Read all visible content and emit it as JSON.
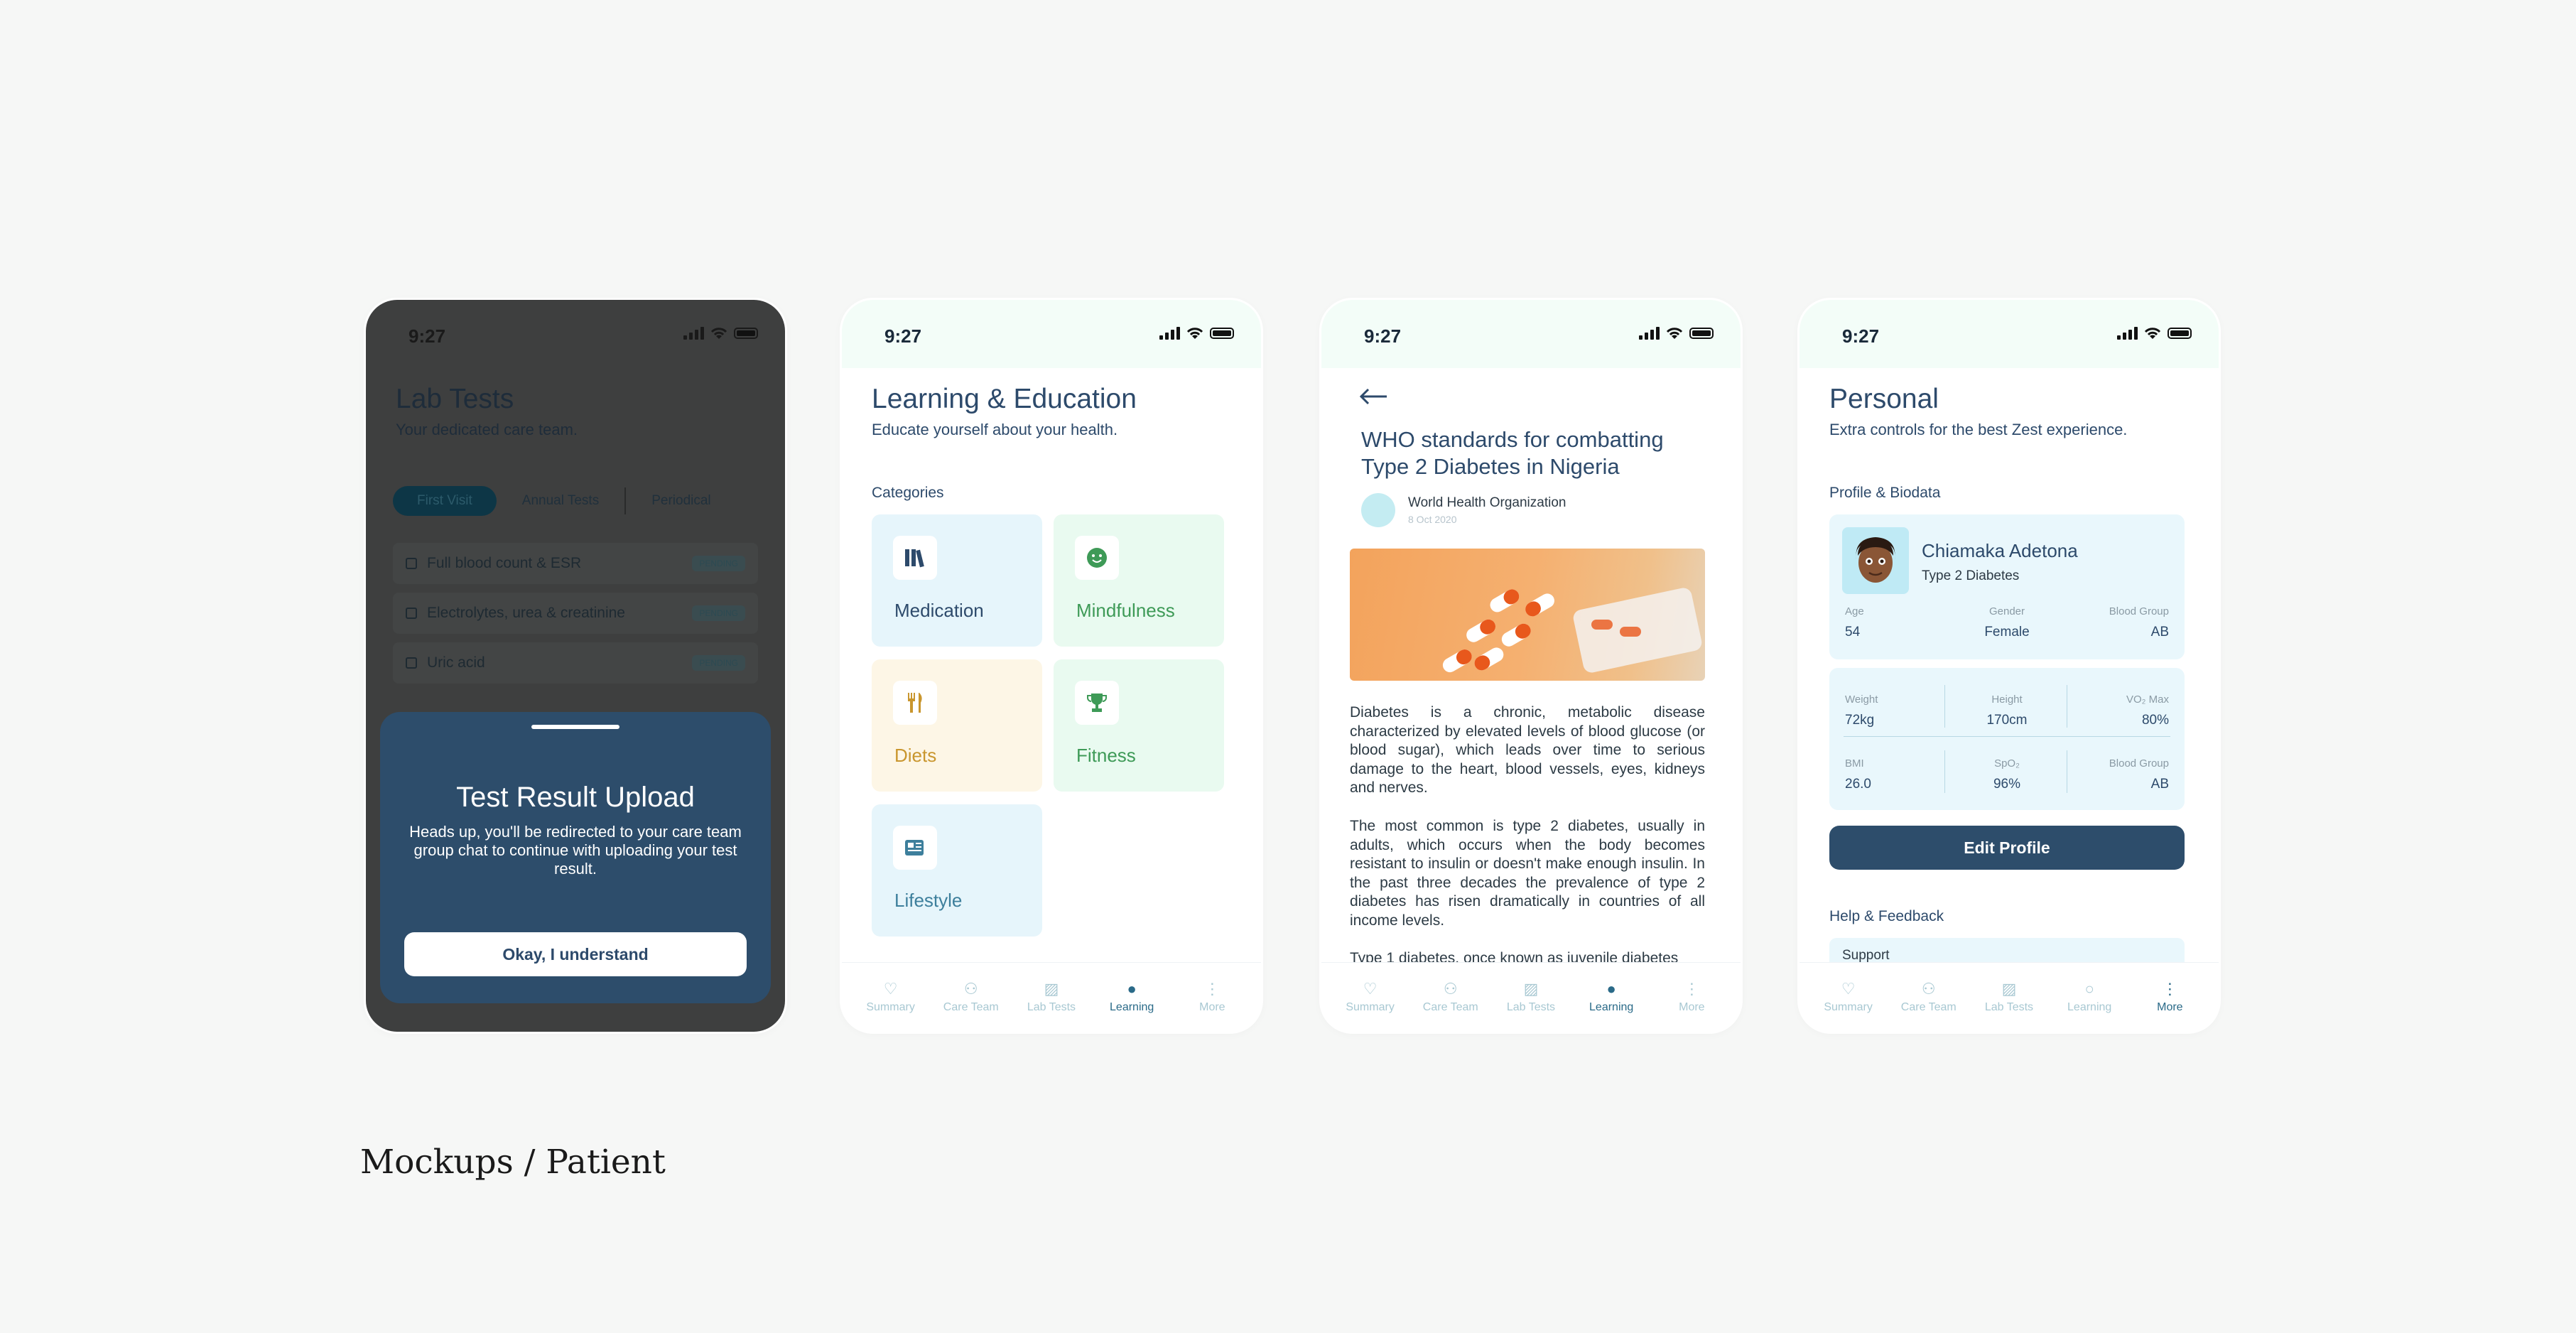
{
  "status_time": "9:27",
  "caption": "Mockups / Patient",
  "tabs": [
    "Summary",
    "Care Team",
    "Lab Tests",
    "Learning",
    "More"
  ],
  "lab_tests": {
    "title": "Lab Tests",
    "subtitle": "Your dedicated care team.",
    "segments": [
      "First Visit",
      "Annual Tests",
      "Periodical"
    ],
    "rows": [
      {
        "label": "Full blood count & ESR",
        "badge": "PENDING"
      },
      {
        "label": "Electrolytes, urea & creatinine",
        "badge": "PENDING"
      },
      {
        "label": "Uric acid",
        "badge": "PENDING"
      }
    ],
    "sheet": {
      "title": "Test Result Upload",
      "text": "Heads up, you'll be redirected to your care team group chat to continue with uploading your test result.",
      "button": "Okay, I understand"
    }
  },
  "learning": {
    "title": "Learning & Education",
    "subtitle": "Educate yourself about your health.",
    "categories_label": "Categories",
    "categories": [
      {
        "label": "Medication",
        "icon": "books-icon",
        "color": "#2d4a6b",
        "bg": "#e6f5fb"
      },
      {
        "label": "Mindfulness",
        "icon": "smile-icon",
        "color": "#3e9a57",
        "bg": "#e9faf0"
      },
      {
        "label": "Diets",
        "icon": "cutlery-icon",
        "color": "#c9962e",
        "bg": "#fdf6e6"
      },
      {
        "label": "Fitness",
        "icon": "trophy-icon",
        "color": "#3e9a57",
        "bg": "#e9faf0"
      },
      {
        "label": "Lifestyle",
        "icon": "newspaper-icon",
        "color": "#3d7f9c",
        "bg": "#e6f5fb"
      }
    ]
  },
  "article": {
    "title": "WHO standards for combatting Type 2 Diabetes in Nigeria",
    "author": "World Health Organization",
    "date": "8 Oct 2020",
    "paragraphs": [
      "Diabetes is a chronic, metabolic disease characterized by elevated levels of blood glucose (or blood sugar), which leads over time to serious damage to the heart, blood vessels, eyes, kidneys and nerves.",
      "The most common is type 2 diabetes, usually in adults, which occurs when the body becomes resistant to insulin or doesn't make enough insulin. In the past three decades the prevalence of type 2 diabetes has risen dramatically in countries of all income levels.",
      "Type 1 diabetes, once known as juvenile diabetes"
    ]
  },
  "personal": {
    "title": "Personal",
    "subtitle": "Extra controls for the best Zest experience.",
    "profile_label": "Profile & Biodata",
    "name": "Chiamaka Adetona",
    "condition": "Type 2 Diabetes",
    "bio": [
      {
        "k": "Age",
        "v": "54"
      },
      {
        "k": "Gender",
        "v": "Female"
      },
      {
        "k": "Blood Group",
        "v": "AB"
      }
    ],
    "vitals_top": [
      {
        "k": "Weight",
        "v": "72kg"
      },
      {
        "k": "Height",
        "v": "170cm"
      },
      {
        "k": "VO₂ Max",
        "v": "80%"
      }
    ],
    "vitals_bottom": [
      {
        "k": "BMI",
        "v": "26.0"
      },
      {
        "k": "SpO₂",
        "v": "96%"
      },
      {
        "k": "Blood Group",
        "v": "AB"
      }
    ],
    "edit_button": "Edit Profile",
    "help_label": "Help & Feedback",
    "support_label": "Support"
  }
}
